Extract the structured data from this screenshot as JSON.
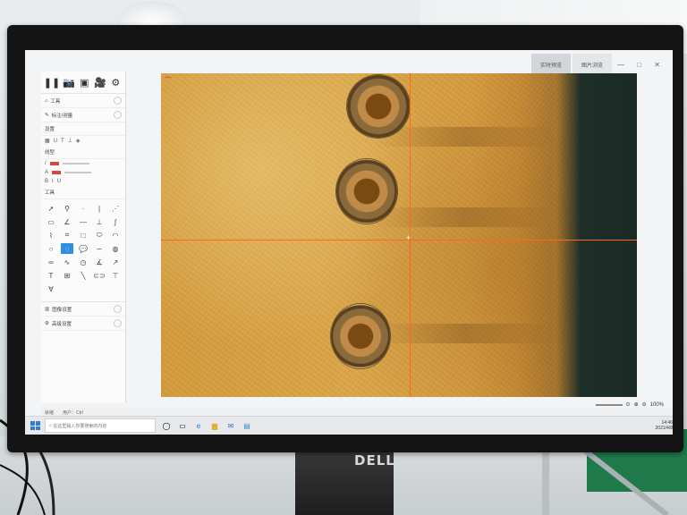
{
  "monitor": {
    "brand": "DELL"
  },
  "app": {
    "tabs": [
      {
        "label": "实时预览",
        "active": true
      },
      {
        "label": "图片浏览",
        "active": false
      }
    ],
    "window_controls": "— □ ✕",
    "left_panel": {
      "top_icons": [
        "pause-icon",
        "camera-icon",
        "layers-icon",
        "video-icon",
        "settings-icon"
      ],
      "sections": [
        {
          "label": "工具"
        },
        {
          "label": "标注/测量"
        },
        {
          "label": "设置"
        },
        {
          "label": "线型"
        },
        {
          "label": "工具"
        }
      ],
      "bottom_items": [
        {
          "label": "图像设置"
        },
        {
          "label": "高级设置"
        }
      ]
    },
    "status_bar": {
      "left": "就绪",
      "mid": "用户：Ctrl"
    },
    "zoom": {
      "value": "100%"
    },
    "colors": {
      "accent": "#2e8fe0",
      "crosshair": "#ff6a1a",
      "annotation": "#d9463a"
    }
  },
  "taskbar": {
    "search_placeholder": "在这里输入你要搜索的内容",
    "tray_time": "14:46",
    "tray_date": "2021/4/8"
  }
}
